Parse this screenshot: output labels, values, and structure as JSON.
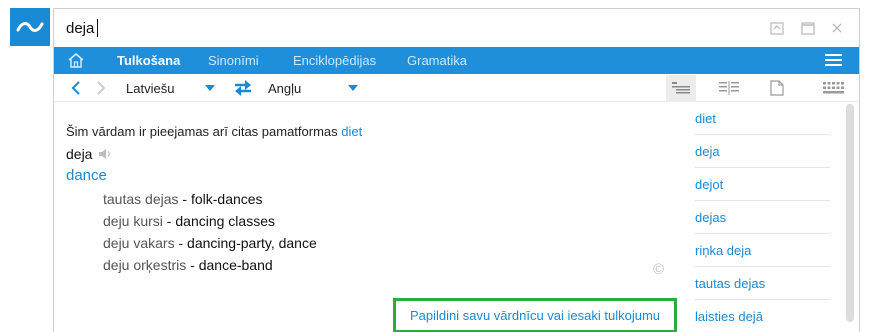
{
  "search": {
    "value": "deja"
  },
  "nav": {
    "tabs": [
      {
        "label": "Tulkošana",
        "active": true
      },
      {
        "label": "Sinonīmi",
        "active": false
      },
      {
        "label": "Enciklopēdijas",
        "active": false
      },
      {
        "label": "Gramatika",
        "active": false
      }
    ]
  },
  "lang": {
    "source": "Latviešu",
    "target": "Angļu"
  },
  "entry": {
    "notice_text": "Šim vārdam ir pieejamas arī citas pamatformas",
    "notice_link": "diet",
    "headword": "deja",
    "translation": "dance",
    "phrases": [
      {
        "source": "tautas dejas",
        "target": "folk-dances"
      },
      {
        "source": "deju kursi",
        "target": "dancing classes"
      },
      {
        "source": "deju vakars",
        "target": "dancing-party, dance"
      },
      {
        "source": "deju orķestris",
        "target": "dance-band"
      }
    ],
    "separator": " - "
  },
  "copyright_symbol": "©",
  "suggest_link": "Papildini savu vārdnīcu vai iesaki tulkojumu",
  "sidebar": {
    "items": [
      "diet",
      "deja",
      "dejot",
      "dejas",
      "riņka deja",
      "tautas dejas",
      "laisties dejā"
    ]
  },
  "colors": {
    "accent": "#1a8ad4",
    "navbar": "#1f8fdb",
    "highlight_border": "#2aad3e"
  }
}
